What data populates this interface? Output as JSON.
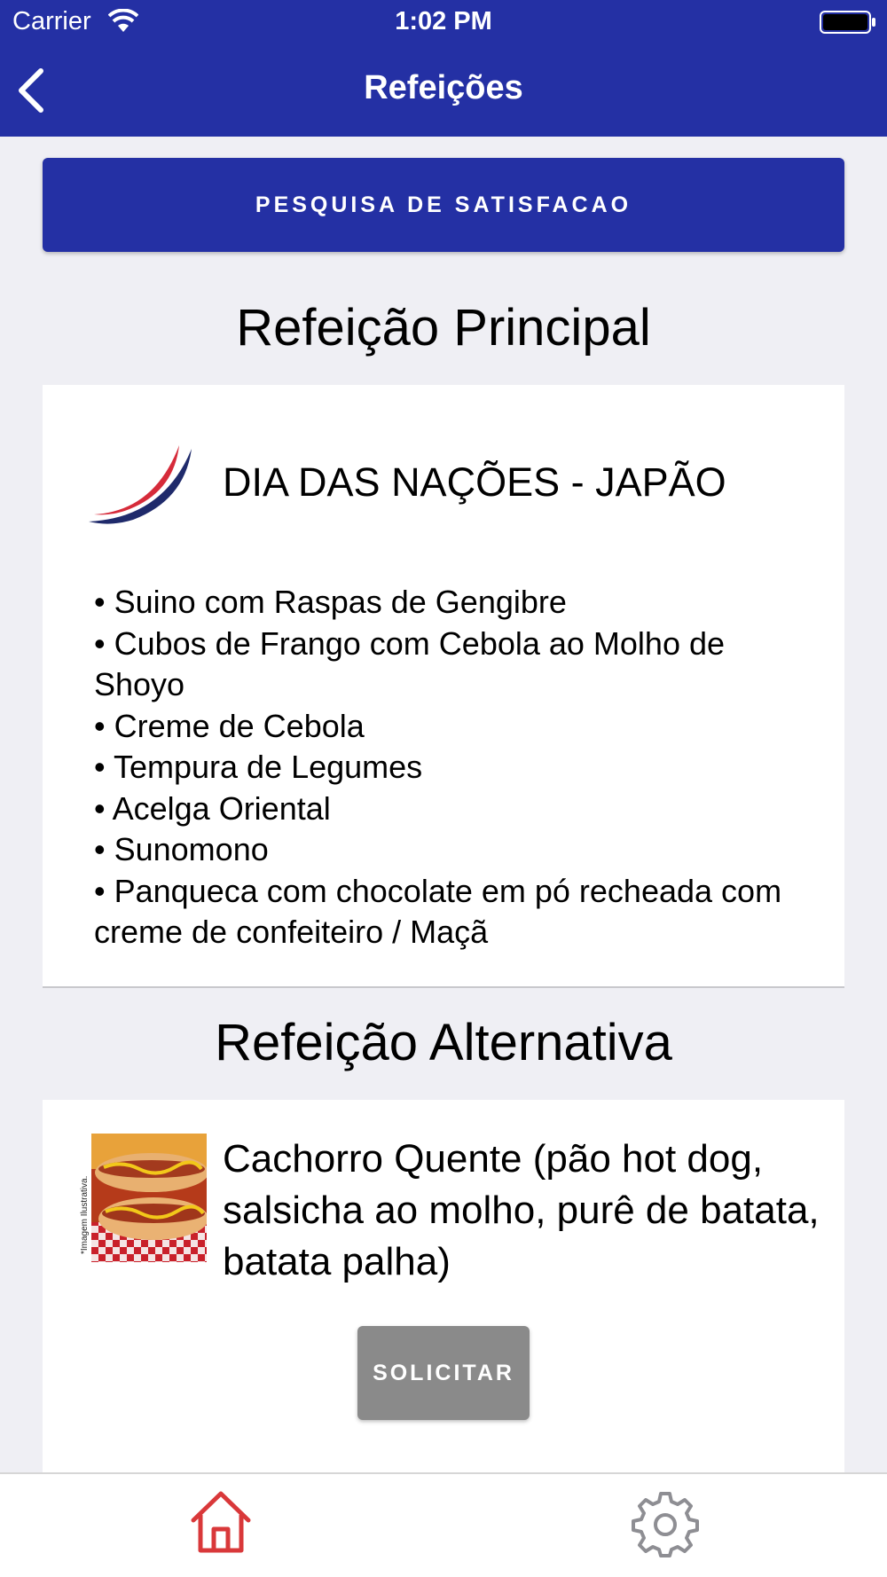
{
  "status_bar": {
    "carrier": "Carrier",
    "time": "1:02 PM"
  },
  "nav": {
    "title": "Refeições",
    "back_icon": "chevron-left-icon"
  },
  "survey_button": {
    "label": "PESQUISA DE SATISFACAO"
  },
  "main_meal": {
    "section_title": "Refeição Principal",
    "name": "DIA DAS NAÇÕES - JAPÃO",
    "items": [
      "• Suino com Raspas de Gengibre",
      "• Cubos de Frango com Cebola ao Molho de Shoyo",
      "• Creme de Cebola",
      "• Tempura de Legumes",
      "• Acelga Oriental",
      "• Sunomono",
      "• Panqueca com chocolate em pó recheada com creme de confeiteiro /  Maçã"
    ]
  },
  "alternative_meal": {
    "section_title": "Refeição Alternativa",
    "name": "Cachorro Quente (pão hot dog, salsicha ao molho, purê de batata, batata palha)",
    "image_caption": "*Imagem Ilustrativa.",
    "request_label": "SOLICITAR"
  },
  "tab_bar": {
    "home_icon": "home-icon",
    "settings_icon": "gear-icon"
  },
  "colors": {
    "primary": "#2430a4",
    "disabled_button": "#8a8a8a",
    "home_tab_active": "#d9383a",
    "settings_tab": "#8e8e93"
  }
}
